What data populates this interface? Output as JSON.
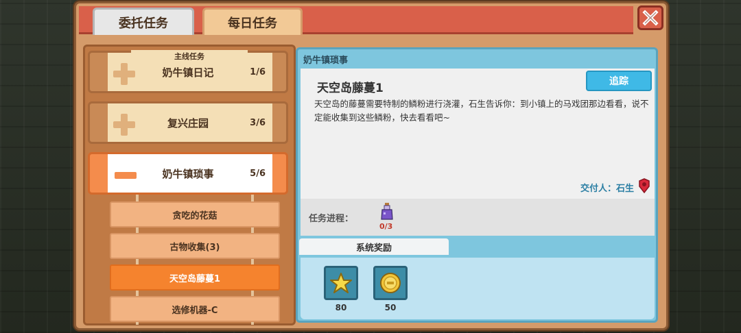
{
  "tabs": {
    "commission": "委托任务",
    "daily": "每日任务"
  },
  "quest_list": {
    "main_tag": "主线任务",
    "main_entries": [
      {
        "title": "奶牛镇日记",
        "count": "1/6"
      },
      {
        "title": "复兴庄园",
        "count": "3/6"
      },
      {
        "title": "奶牛镇琐事",
        "count": "5/6"
      }
    ],
    "sub_entries": [
      "贪吃的花菇",
      "古物收集(3)",
      "天空岛藤蔓1",
      "选修机器-C"
    ]
  },
  "detail": {
    "header": "奶牛镇琐事",
    "title": "天空岛藤蔓1",
    "description": "天空岛的藤蔓需要特制的鳞粉进行浇灌，石生告诉你：到小镇上的马戏团那边看看，说不定能收集到这些鳞粉，快去看看吧~",
    "track_button": "追踪",
    "giver": "交付人：石生",
    "progress_label": "任务进程：",
    "progress_count": "0/3",
    "reward_tab": "系统奖励",
    "rewards": [
      {
        "icon": "star-icon",
        "count": "80"
      },
      {
        "icon": "coin-icon",
        "count": "50"
      }
    ]
  },
  "colors": {
    "accent": "#f48c4c",
    "track": "#3fb9e6",
    "panel": "#d59b6a"
  }
}
